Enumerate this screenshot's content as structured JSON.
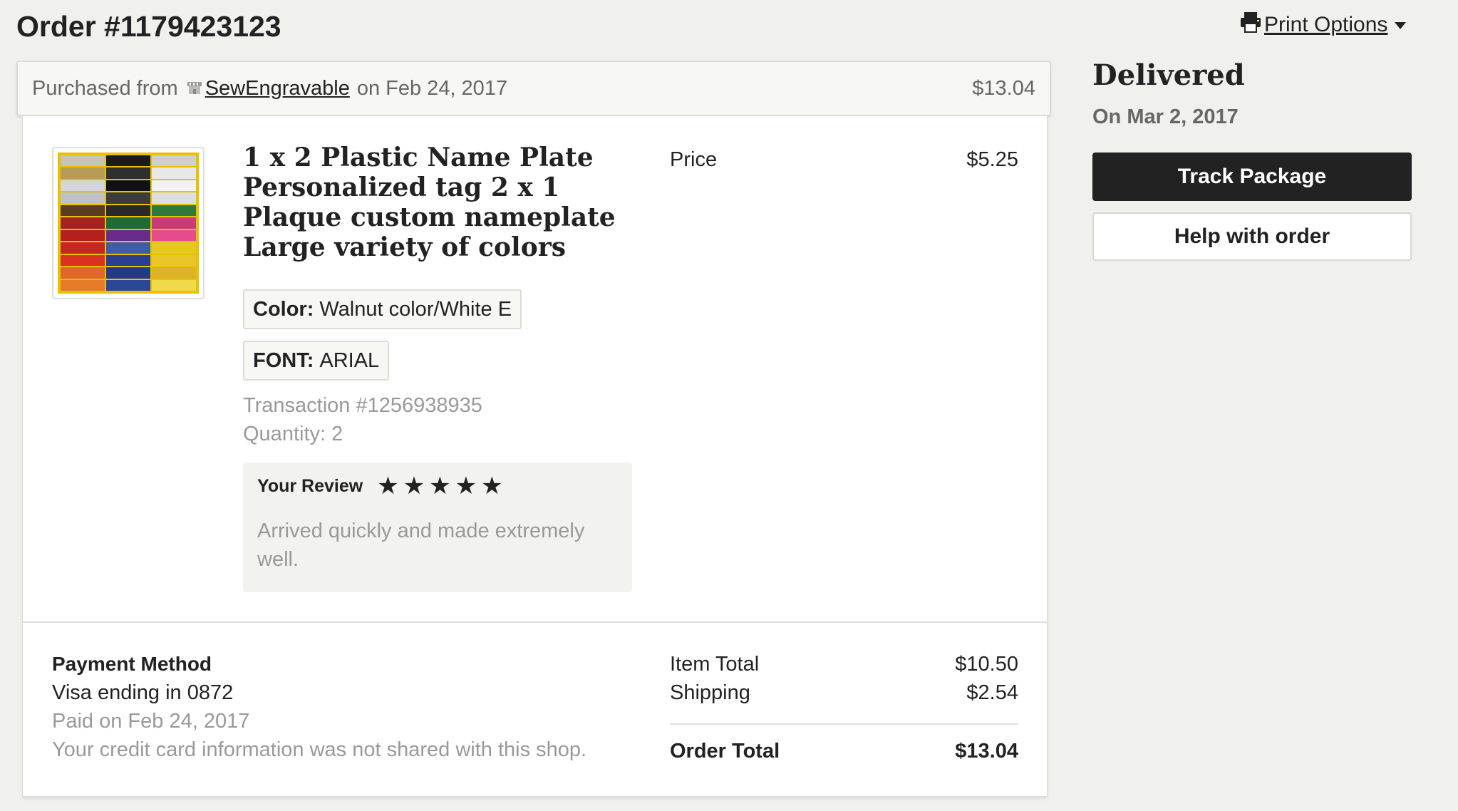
{
  "header": {
    "order_title": "Order #1179423123",
    "print_options_label": "Print Options"
  },
  "purchase": {
    "prefix": "Purchased from",
    "shop_name": "SewEngravable",
    "date_text": "on Feb 24, 2017",
    "total": "$13.04"
  },
  "item": {
    "title": "1 x 2 Plastic Name Plate Personalized tag 2 x 1 Plaque custom nameplate Large variety of colors",
    "price_label": "Price",
    "price_value": "$5.25",
    "variations": [
      {
        "name": "Color:",
        "value": "Walnut color/White E"
      },
      {
        "name": "FONT:",
        "value": "ARIAL"
      }
    ],
    "transaction": "Transaction #1256938935",
    "quantity": "Quantity: 2",
    "review": {
      "label": "Your Review",
      "rating": 5,
      "text": "Arrived quickly and made extremely well."
    }
  },
  "payment": {
    "heading": "Payment Method",
    "card": "Visa ending in 0872",
    "paid_on": "Paid on Feb 24, 2017",
    "note": "Your credit card information was not shared with this shop."
  },
  "summary": {
    "item_total_label": "Item Total",
    "item_total_value": "$10.50",
    "shipping_label": "Shipping",
    "shipping_value": "$2.54",
    "order_total_label": "Order Total",
    "order_total_value": "$13.04"
  },
  "status": {
    "title": "Delivered",
    "date": "On Mar 2, 2017",
    "track_button": "Track Package",
    "help_button": "Help with order"
  },
  "icons": {
    "print": "printer-icon",
    "shop": "shop-icon",
    "star": "star-icon"
  },
  "colors": {
    "background": "#f0f0ed",
    "primary_button": "#222222",
    "muted_text": "#999999"
  }
}
